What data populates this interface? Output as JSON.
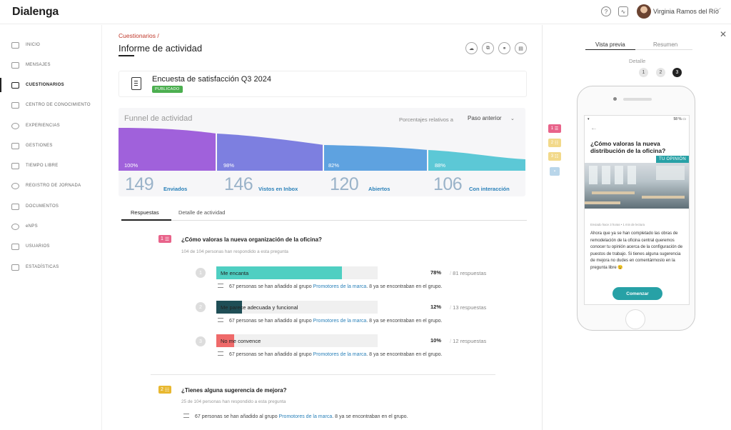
{
  "app": {
    "logo": "Dialenga",
    "user_name": "Virginia Ramos del Río"
  },
  "sidebar": {
    "items": [
      {
        "label": "Inicio"
      },
      {
        "label": "Mensajes"
      },
      {
        "label": "Cuestionarios",
        "active": true
      },
      {
        "label": "Centro de conocimiento"
      },
      {
        "label": "Experiencias"
      },
      {
        "label": "Gestiones"
      },
      {
        "label": "Tiempo libre"
      },
      {
        "label": "Registro de jornada"
      },
      {
        "label": "Documentos"
      },
      {
        "label": "eNPS"
      },
      {
        "label": "Usuarios"
      },
      {
        "label": "Estadísticas"
      }
    ]
  },
  "page": {
    "breadcrumb": "Cuestionarios /",
    "title": "Informe de actividad"
  },
  "survey": {
    "name": "Encuesta de satisfacción Q3 2024",
    "status": "PUBLICADO"
  },
  "funnel": {
    "title": "Funnel de actividad",
    "relative_label": "Porcentajes relativos a",
    "relative_value": "Paso anterior",
    "colors": [
      "#9b59d9",
      "#7d7fe0",
      "#5ea2e0",
      "#5cc8d6"
    ],
    "steps": [
      {
        "pct": "100%",
        "count": "149",
        "label": "Enviados"
      },
      {
        "pct": "98%",
        "count": "146",
        "label": "Vistos en Inbox"
      },
      {
        "pct": "82%",
        "count": "120",
        "label": "Abiertos"
      },
      {
        "pct": "88%",
        "count": "106",
        "label": "Con interacción"
      }
    ]
  },
  "tabs": {
    "responses": "Respuestas",
    "activity": "Detalle de actividad"
  },
  "questions": [
    {
      "badge": "1",
      "title": "¿Cómo valoras la nueva organización de la oficina?",
      "subtitle": "104 de 104 personas han respondido a esta pregunta",
      "options": [
        {
          "num": "1",
          "label": "Me encanta",
          "pct": "78%",
          "responses": "81 respuestas",
          "fill": 0.78,
          "color": "#4fcfc2",
          "note_a": "67 personas se han añadido al grupo ",
          "note_link": "Promotores de la marca",
          "note_b": ". 8 ya se encontraban en el grupo."
        },
        {
          "num": "2",
          "label": "Me parece adecuada y funcional",
          "pct": "12%",
          "responses": "13 respuestas",
          "fill": 0.16,
          "color": "#1f4e56",
          "note_a": "67 personas se han añadido al grupo ",
          "note_link": "Promotores de la marca",
          "note_b": ". 8 ya se encontraban en el grupo."
        },
        {
          "num": "3",
          "label": "No me convence",
          "pct": "10%",
          "responses": "12 respuestas",
          "fill": 0.11,
          "color": "#ef6a6a",
          "note_a": "67 personas se han añadido al grupo ",
          "note_link": "Promotores de la marca",
          "note_b": ". 8 ya se encontraban en el grupo."
        }
      ]
    },
    {
      "badge": "2",
      "title": "¿Tienes alguna sugerencia de mejora?",
      "subtitle": "25 de 104 personas han respondido a esta pregunta",
      "note_a": "67 personas se han añadido al grupo ",
      "note_link": "Promotores de la marca",
      "note_b": ". 8 ya se encontraban en el grupo."
    }
  ],
  "panel": {
    "tabs": [
      "Vista previa",
      "Resumen"
    ],
    "detail_label": "Detalle",
    "steps": [
      "1",
      "2",
      "3"
    ],
    "question_chips": [
      "1",
      "2",
      "3"
    ],
    "phone": {
      "battery": "58 %",
      "question": "¿Cómo valoras la nueva distribución de la oficina?",
      "tag": "TU OPINIÓN",
      "meta": "Enviado hace 3 horas  •  1 min de lectura",
      "body": "Ahora que ya se han completado las obras de remodelación de la oficina central queremos conocer tu opinión acerca de la configuración de puestos de trabajo. Si tienes alguna sugerencia de mejora no dudes en comentármoslo en la pregunta libre 😉",
      "button": "Comenzar"
    }
  },
  "accent_colors": {
    "q1": "#e8638a",
    "q2": "#e8b830",
    "q2_light": "#f2d98a",
    "teal": "#27a1a6",
    "link": "#2980b9"
  }
}
